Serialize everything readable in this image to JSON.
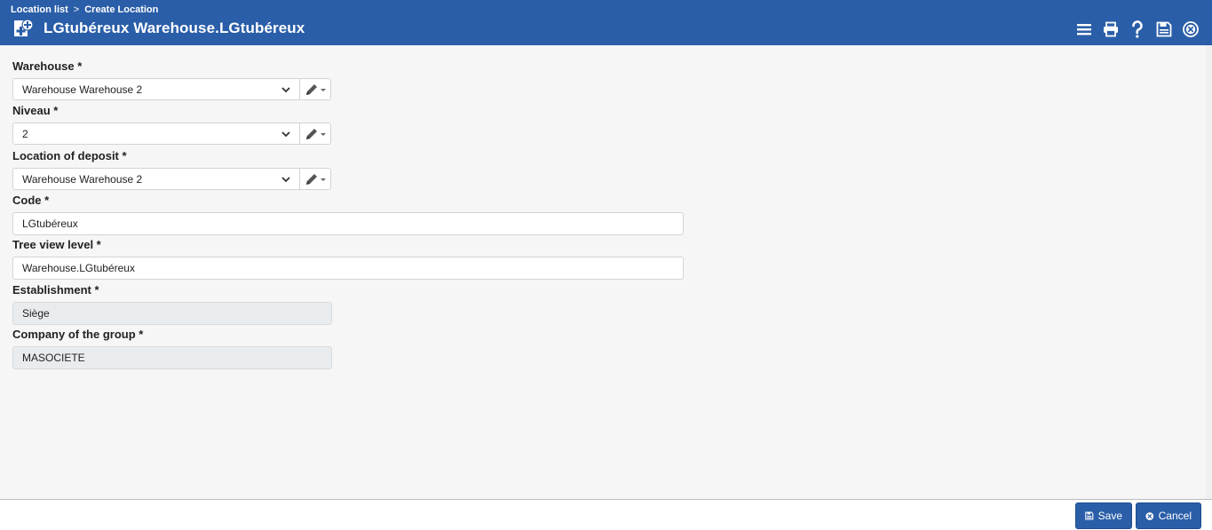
{
  "breadcrumb": {
    "items": [
      "Location list",
      "Create Location"
    ],
    "separator": ">"
  },
  "header": {
    "title": "LGtubéreux Warehouse.LGtubéreux",
    "icon": "add-document-icon",
    "toolbar": [
      "menu-icon",
      "print-icon",
      "help-icon",
      "save-icon",
      "close-icon"
    ]
  },
  "form": {
    "warehouse": {
      "label": "Warehouse *",
      "value": "Warehouse Warehouse 2"
    },
    "niveau": {
      "label": "Niveau *",
      "value": "2"
    },
    "location_of_deposit": {
      "label": "Location of deposit *",
      "value": "Warehouse Warehouse 2"
    },
    "code": {
      "label": "Code *",
      "value": "LGtubéreux"
    },
    "tree_view_level": {
      "label": "Tree view level *",
      "value": "Warehouse.LGtubéreux"
    },
    "establishment": {
      "label": "Establishment *",
      "value": "Siège"
    },
    "company_of_the_group": {
      "label": "Company of the group *",
      "value": "MASOCIETE"
    }
  },
  "footer": {
    "save_label": "Save",
    "cancel_label": "Cancel"
  },
  "colors": {
    "header_bg": "#2a5ea8",
    "page_bg": "#f6f6f6",
    "readonly_bg": "#e9ecef"
  }
}
